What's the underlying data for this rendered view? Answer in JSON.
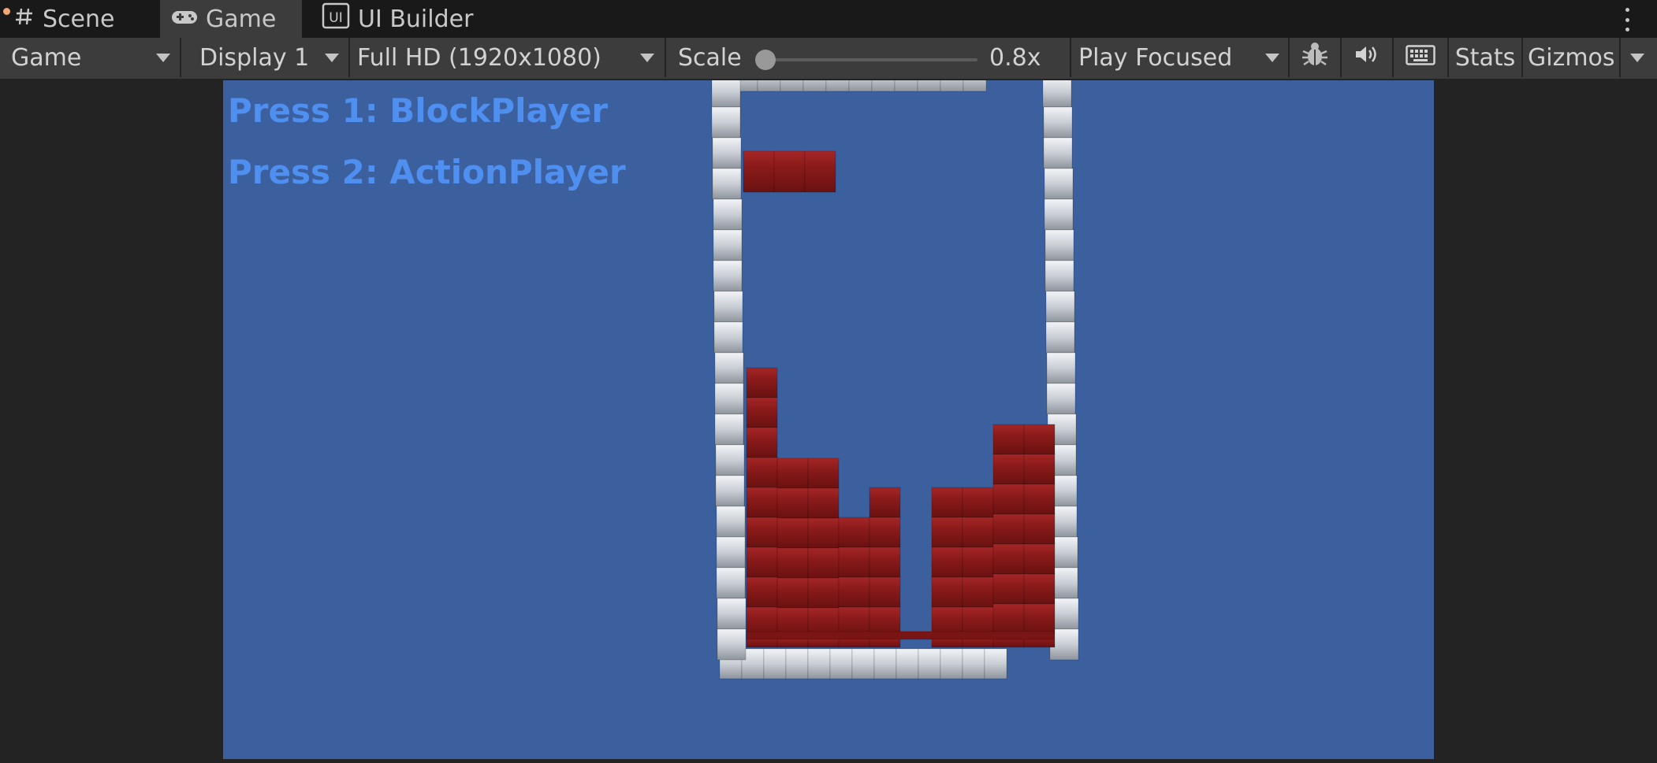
{
  "tabs": [
    {
      "label": "Scene",
      "icon": "hash-icon"
    },
    {
      "label": "Game",
      "icon": "gamepad-icon"
    },
    {
      "label": "UI Builder",
      "icon": "ui-builder-icon"
    }
  ],
  "toolbar": {
    "view_mode": "Game",
    "display": "Display 1",
    "resolution": "Full HD (1920x1080)",
    "scale_label": "Scale",
    "scale_value": "0.8x",
    "play_mode": "Play Focused",
    "stats_label": "Stats",
    "gizmos_label": "Gizmos"
  },
  "game": {
    "hud": [
      "Press 1: BlockPlayer",
      "Press 2: ActionPlayer"
    ],
    "colors": {
      "background": "#3c5f9e",
      "block": "#8a1a1a",
      "wall": "#c8cdd4",
      "hud_text": "#4f8ff0"
    }
  }
}
